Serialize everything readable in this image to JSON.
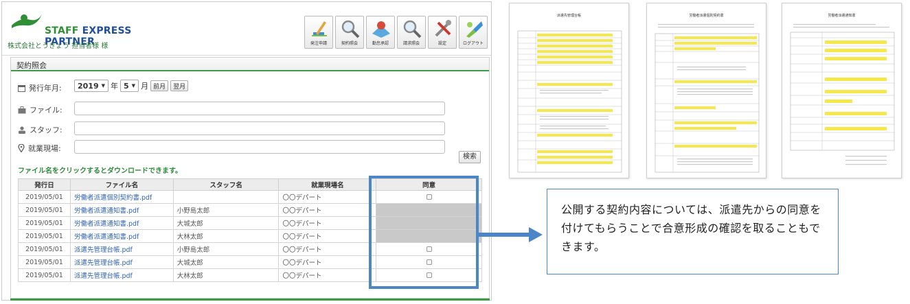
{
  "app": {
    "logo_text_a": "STAFF",
    "logo_text_b": " EXPRESS PARTNER",
    "company": "株式会社とうきょう 担当者様 様",
    "toolbar": [
      {
        "label": "発注申請",
        "icon": "pencil-icon"
      },
      {
        "label": "契約照会",
        "icon": "magnifier-icon"
      },
      {
        "label": "勤怠承認",
        "icon": "approve-icon"
      },
      {
        "label": "請求照会",
        "icon": "invoice-search-icon"
      },
      {
        "label": "設定",
        "icon": "tools-icon"
      },
      {
        "label": "ログアウト",
        "icon": "logout-icon"
      }
    ]
  },
  "panel": {
    "title": "契約照会",
    "issue_label": "発行年月:",
    "year": "2019",
    "year_unit": "年",
    "month": "5",
    "month_unit": "月",
    "prev_label": "前月",
    "next_label": "翌月",
    "file_label": "ファイル:",
    "staff_label": "スタッフ:",
    "site_label": "就業現場:",
    "search_label": "検索",
    "hint": "ファイル名をクリックするとダウンロードできます。"
  },
  "table": {
    "headers": [
      "発行日",
      "ファイル名",
      "スタッフ名",
      "就業現場名",
      "同意"
    ],
    "rows": [
      {
        "date": "2019/05/01",
        "file": "労働者派遣個別契約書.pdf",
        "staff": "",
        "site": "〇〇デパート",
        "agree": "checkbox"
      },
      {
        "date": "2019/05/01",
        "file": "労働者派遣通知書.pdf",
        "staff": "小野島太郎",
        "site": "〇〇デパート",
        "agree": "grey"
      },
      {
        "date": "2019/05/01",
        "file": "労働者派遣通知書.pdf",
        "staff": "大城太郎",
        "site": "〇〇デパート",
        "agree": "grey"
      },
      {
        "date": "2019/05/01",
        "file": "労働者派遣通知書.pdf",
        "staff": "大林太郎",
        "site": "〇〇デパート",
        "agree": "grey"
      },
      {
        "date": "2019/05/01",
        "file": "派遣先管理台帳.pdf",
        "staff": "小野島太郎",
        "site": "〇〇デパート",
        "agree": "checkbox"
      },
      {
        "date": "2019/05/01",
        "file": "派遣先管理台帳.pdf",
        "staff": "大城太郎",
        "site": "〇〇デパート",
        "agree": "checkbox"
      },
      {
        "date": "2019/05/01",
        "file": "派遣先管理台帳.pdf",
        "staff": "大林太郎",
        "site": "〇〇デパート",
        "agree": "checkbox"
      }
    ]
  },
  "callout": {
    "text": "公開する契約内容については、派遣先からの同意を付けてもらうことで合意形成の確認を取ることもできます。"
  },
  "docs": [
    {
      "title": "派遣先管理台帳"
    },
    {
      "title": "労働者派遣個別契約書"
    },
    {
      "title": "労働者派遣通知書"
    }
  ],
  "colors": {
    "accent_green": "#3e9a48",
    "highlight_blue": "#4a86c8",
    "link_blue": "#2f63b1",
    "doc_yellow": "#f6e84a"
  }
}
